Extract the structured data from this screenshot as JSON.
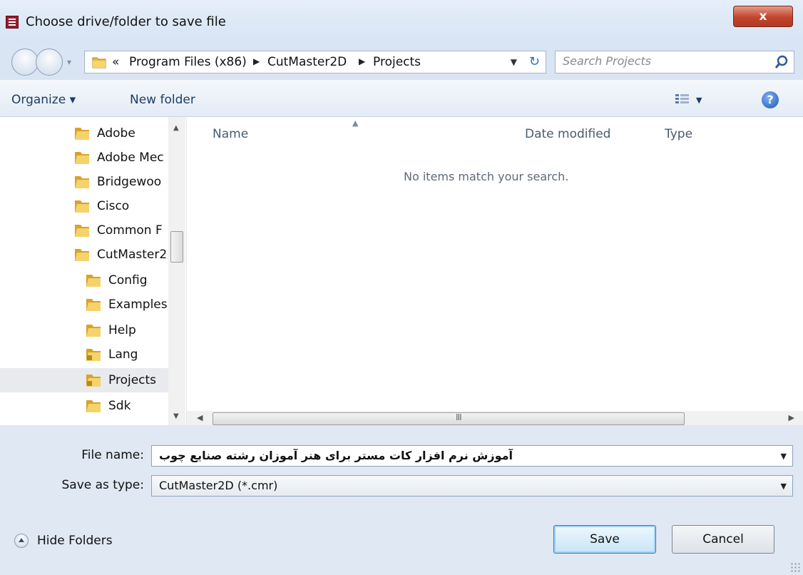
{
  "window": {
    "title": "Choose drive/folder to save file",
    "close_label": "x"
  },
  "address": {
    "overflow": "«",
    "crumbs": [
      "Program Files (x86)",
      "CutMaster2D",
      "Projects"
    ],
    "search_placeholder": "Search Projects"
  },
  "toolbar": {
    "organize_label": "Organize ▾",
    "new_folder_label": "New folder",
    "help_label": "?"
  },
  "nav_tree": {
    "items": [
      {
        "label": "Adobe",
        "level": 0
      },
      {
        "label": "Adobe Mec",
        "level": 0
      },
      {
        "label": "Bridgewoo",
        "level": 0
      },
      {
        "label": "Cisco",
        "level": 0
      },
      {
        "label": "Common F",
        "level": 0
      },
      {
        "label": "CutMaster2",
        "level": 0
      },
      {
        "label": "Config",
        "level": 1
      },
      {
        "label": "Examples",
        "level": 1
      },
      {
        "label": "Help",
        "level": 1
      },
      {
        "label": "Lang",
        "level": 1
      },
      {
        "label": "Projects",
        "level": 1,
        "selected": true
      },
      {
        "label": "Sdk",
        "level": 1
      }
    ]
  },
  "file_list": {
    "columns": [
      "Name",
      "Date modified",
      "Type"
    ],
    "empty_message": "No items match your search."
  },
  "form": {
    "file_name_label": "File name:",
    "file_name_value": "آموزش نرم افزار کات مستر برای هنر آموزان رشته صنایع چوب",
    "save_type_label": "Save as type:",
    "save_type_value": "CutMaster2D (*.cmr)"
  },
  "footer": {
    "hide_folders_label": "Hide Folders",
    "save_label": "Save",
    "cancel_label": "Cancel"
  },
  "colors": {
    "close_red": "#c2452d",
    "selection": "#e8eaee",
    "link_blue": "#1e3c66"
  }
}
